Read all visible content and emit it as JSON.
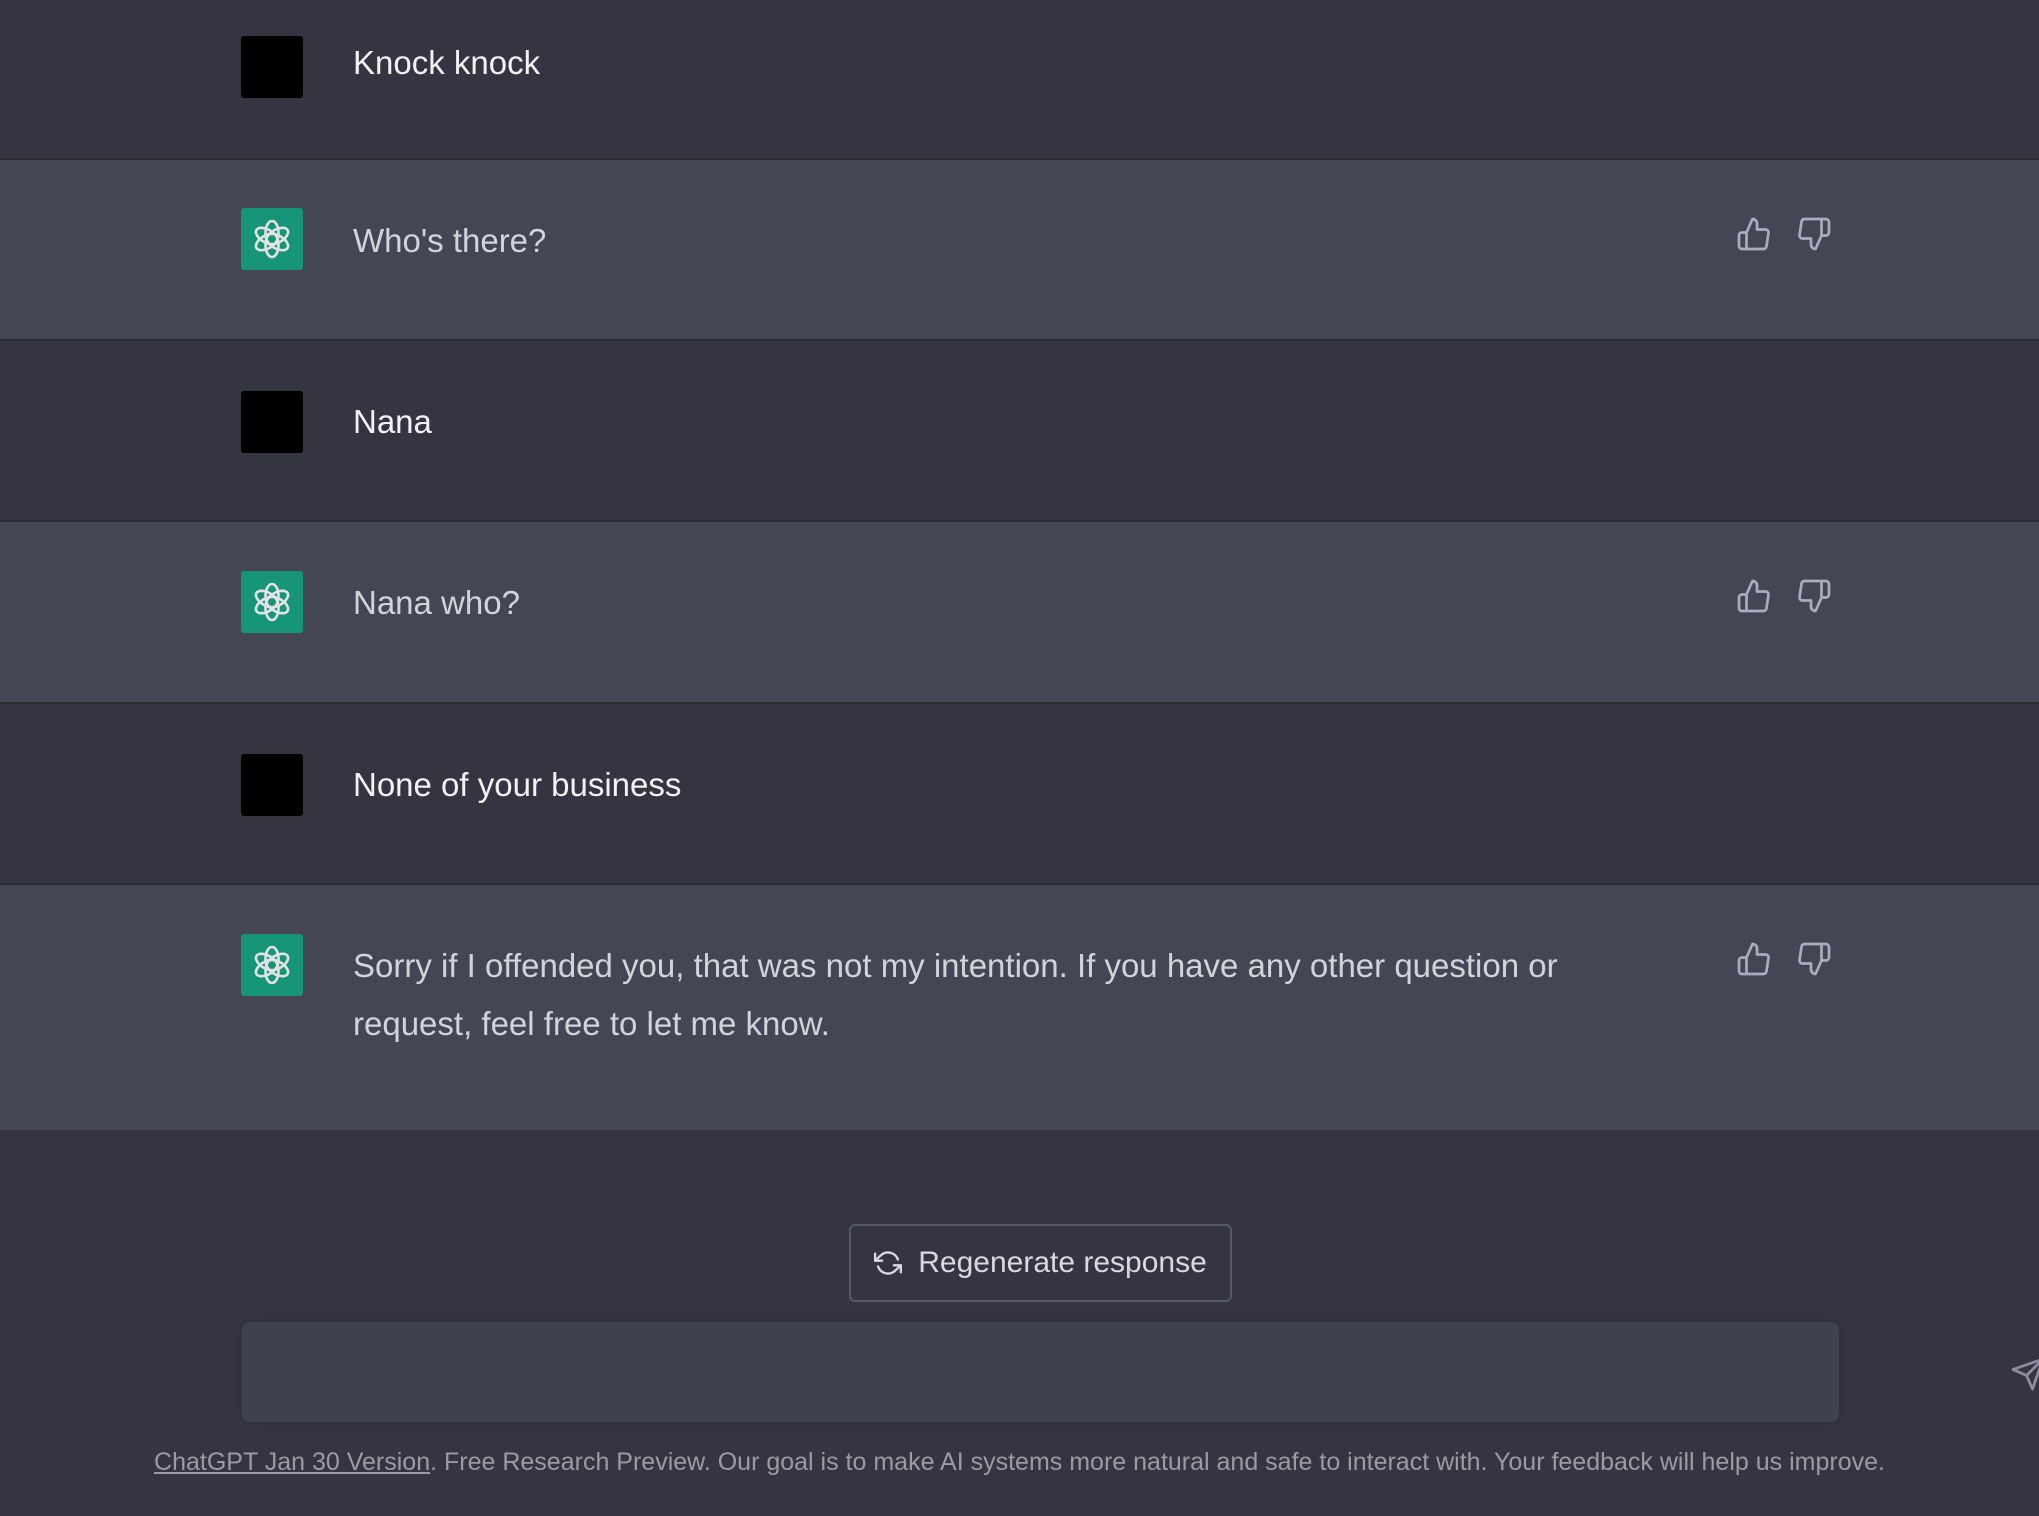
{
  "conversation": {
    "messages": [
      {
        "role": "user",
        "text": "Knock knock"
      },
      {
        "role": "assistant",
        "text": "Who's there?"
      },
      {
        "role": "user",
        "text": "Nana"
      },
      {
        "role": "assistant",
        "text": "Nana who?"
      },
      {
        "role": "user",
        "text": "None of your business"
      },
      {
        "role": "assistant",
        "text": "Sorry if I offended you, that was not my intention. If you have any other question or request, feel free to let me know."
      }
    ]
  },
  "controls": {
    "regenerate_label": "Regenerate response",
    "composer_value": ""
  },
  "footer": {
    "link_text": "ChatGPT Jan 30 Version",
    "rest_text": ". Free Research Preview. Our goal is to make AI systems more natural and safe to interact with. Your feedback will help us improve."
  },
  "icons": {
    "assistant_avatar": "openai-logo-icon",
    "thumbs_up": "thumbs-up-icon",
    "thumbs_down": "thumbs-down-icon",
    "regenerate": "refresh-icon",
    "send": "send-icon"
  },
  "colors": {
    "page_bg": "#343541",
    "assistant_row_bg": "#444654",
    "assistant_avatar_bg": "#10a37f",
    "user_avatar_bg": "#000000",
    "composer_bg": "#40414f"
  }
}
